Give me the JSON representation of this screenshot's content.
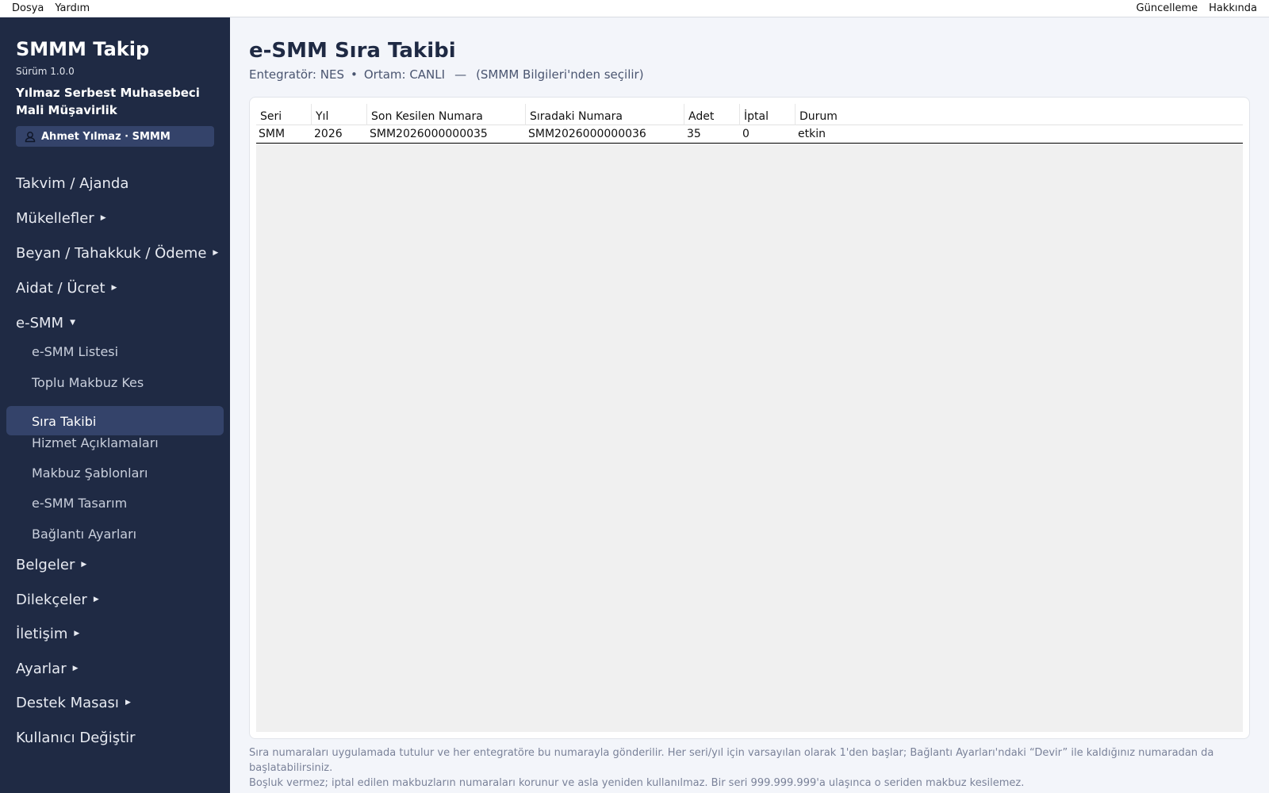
{
  "menubar": {
    "left": [
      "Dosya",
      "Yardım"
    ],
    "right": [
      "Güncelleme",
      "Hakkında"
    ]
  },
  "sidebar": {
    "app_title": "SMMM Takip",
    "version": "Sürüm 1.0.0",
    "company": "Yılmaz Serbest Muhasebeci Mali Müşavirlik",
    "user": "Ahmet Yılmaz · SMMM",
    "nav": {
      "takvim": "Takvim / Ajanda",
      "mukellefler": "Mükellefler",
      "beyan": "Beyan / Tahakkuk / Ödeme",
      "aidat": "Aidat / Ücret",
      "esmm": "e-SMM",
      "belgeler": "Belgeler",
      "dilekceler": "Dilekçeler",
      "iletisim": "İletişim",
      "ayarlar": "Ayarlar",
      "destek": "Destek Masası",
      "kullanici": "Kullanıcı Değiştir"
    },
    "esmm_sub": {
      "liste": "e-SMM Listesi",
      "toplu": "Toplu Makbuz Kes",
      "sira": "Sıra Takibi",
      "hizmet": "Hizmet Açıklamaları",
      "sablon": "Makbuz Şablonları",
      "tasarim": "e-SMM Tasarım",
      "baglanti": "Bağlantı Ayarları"
    },
    "active_item": "Sıra Takibi"
  },
  "main": {
    "title": "e-SMM Sıra Takibi",
    "integrator": "Entegratör: NES",
    "bullet": "•",
    "environment": "Ortam: CANLI",
    "dash": "—",
    "source_note": "(SMMM Bilgileri'nden seçilir)",
    "table": {
      "headers": [
        "Seri",
        "Yıl",
        "Son Kesilen Numara",
        "Sıradaki Numara",
        "Adet",
        "İptal",
        "Durum"
      ],
      "rows": [
        [
          "SMM",
          "2026",
          "SMM2026000000035",
          "SMM2026000000036",
          "35",
          "0",
          "etkin"
        ]
      ]
    },
    "footnote_1": "Sıra numaraları uygulamada tutulur ve her entegratöre bu numarayla gönderilir. Her seri/yıl için varsayılan olarak 1'den başlar; Bağlantı Ayarları'ndaki “Devir” ile kaldığınız numaradan da başlatabilirsiniz.",
    "footnote_2": "Boşluk vermez; iptal edilen makbuzların numaraları korunur ve asla yeniden kullanılmaz. Bir seri 999.999.999'a ulaşınca o seriden makbuz kesilemez."
  },
  "icons": {
    "user": "user-icon",
    "collapsed": "triangle-right-icon",
    "expanded": "triangle-down-icon"
  }
}
